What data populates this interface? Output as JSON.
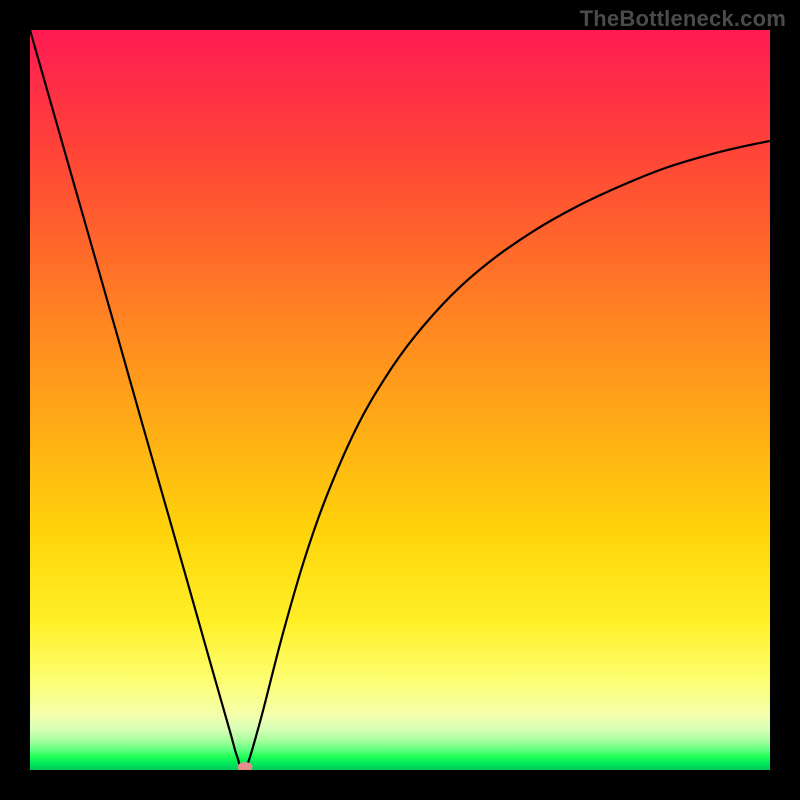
{
  "watermark": "TheBottleneck.com",
  "chart_data": {
    "type": "line",
    "title": "",
    "xlabel": "",
    "ylabel": "",
    "xlim": [
      0,
      100
    ],
    "ylim": [
      0,
      100
    ],
    "series": [
      {
        "name": "bottleneck-curve",
        "x": [
          0,
          3,
          6,
          9,
          12,
          15,
          18,
          21,
          24,
          27,
          28,
          29,
          31,
          34,
          37,
          40,
          44,
          48,
          52,
          57,
          62,
          68,
          74,
          80,
          86,
          92,
          97,
          100
        ],
        "y": [
          100,
          89.5,
          79,
          68.5,
          58,
          47.4,
          36.9,
          26.4,
          15.8,
          5.3,
          1.8,
          0,
          6.2,
          17.8,
          28.2,
          36.8,
          46.0,
          53.0,
          58.6,
          64.2,
          68.6,
          72.8,
          76.2,
          79.0,
          81.4,
          83.2,
          84.4,
          85.0
        ]
      }
    ],
    "marker": {
      "x": 29,
      "y": 0,
      "name": "optimal-point"
    },
    "background_gradient": {
      "stops": [
        {
          "pos": 0,
          "color": "#ff1a52"
        },
        {
          "pos": 0.55,
          "color": "#ffd40a"
        },
        {
          "pos": 0.93,
          "color": "#f3ffab"
        },
        {
          "pos": 1.0,
          "color": "#00c95a"
        }
      ]
    }
  }
}
